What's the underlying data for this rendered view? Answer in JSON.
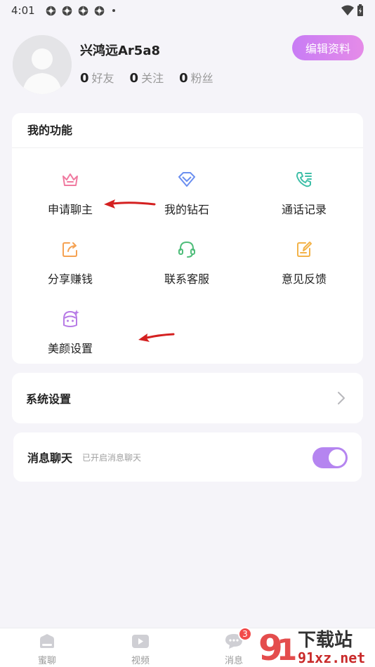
{
  "status_bar": {
    "time": "4:01"
  },
  "profile": {
    "nickname": "兴鸿远Ar5a8",
    "edit_button": "编辑资料",
    "stats": [
      {
        "num": "0",
        "label": "好友"
      },
      {
        "num": "0",
        "label": "关注"
      },
      {
        "num": "0",
        "label": "粉丝"
      }
    ]
  },
  "functions": {
    "title": "我的功能",
    "items": [
      {
        "label": "申请聊主",
        "icon": "crown-icon",
        "color": "#f07aa0"
      },
      {
        "label": "我的钻石",
        "icon": "diamond-icon",
        "color": "#6b8ff0"
      },
      {
        "label": "通话记录",
        "icon": "phone-log-icon",
        "color": "#3fbfa8"
      },
      {
        "label": "分享赚钱",
        "icon": "share-icon",
        "color": "#f5a253"
      },
      {
        "label": "联系客服",
        "icon": "headset-icon",
        "color": "#4fbd7a"
      },
      {
        "label": "意见反馈",
        "icon": "feedback-icon",
        "color": "#f3b34a"
      },
      {
        "label": "美颜设置",
        "icon": "beauty-face-icon",
        "color": "#b77be6"
      }
    ]
  },
  "system_settings": {
    "label": "系统设置"
  },
  "message_chat": {
    "label": "消息聊天",
    "hint": "已开启消息聊天",
    "enabled": true
  },
  "tabbar": {
    "tabs": [
      {
        "label": "蜜聊",
        "icon": "home-icon"
      },
      {
        "label": "视频",
        "icon": "video-icon"
      },
      {
        "label": "消息",
        "icon": "chat-bubble-icon",
        "badge": "3"
      }
    ]
  },
  "watermark": {
    "text_main": "下载站",
    "text_sub": "91xz.net"
  },
  "colors": {
    "accent": "#c87cf5",
    "toggle": "#b585f0",
    "badge": "#f24a4a",
    "arrow": "#d42020"
  }
}
